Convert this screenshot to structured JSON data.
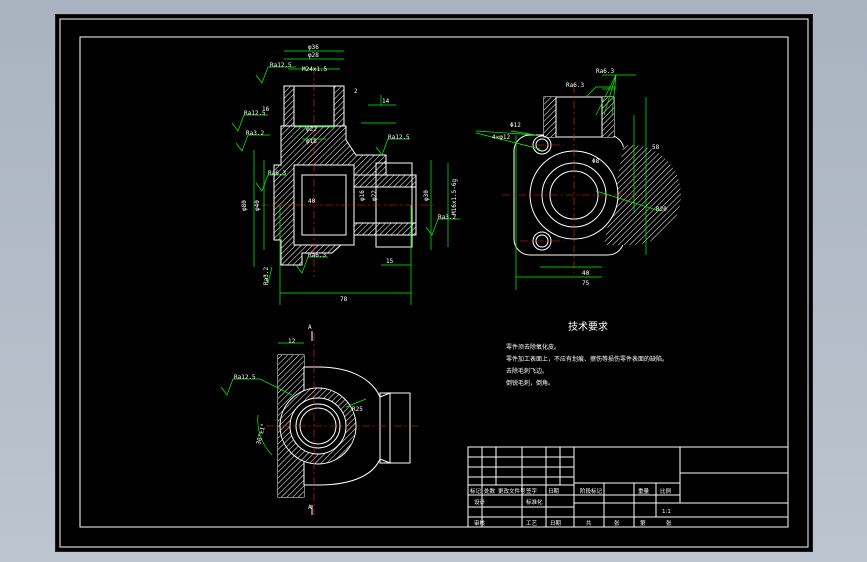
{
  "drawing": {
    "tech_requirements": {
      "title": "技术要求",
      "notes": [
        "零件须去除氧化皮。",
        "零件加工表面上，不应有划痕、擦伤等损伤零件表面的缺陷。",
        "去除毛刺飞边。",
        "倒锐毛刺，倒角。"
      ]
    },
    "dims_front": {
      "d36": "φ36",
      "d28": "φ28",
      "m": "M24x1.5",
      "d22": "φ22",
      "d18": "φ18",
      "d80": "φ80",
      "d40": "φ40",
      "d30": "φ30",
      "d22b": "φ22",
      "d16": "φ16",
      "m2": "M16x1.5-6g",
      "l78": "78",
      "l40": "40",
      "l15": "15",
      "l14": "14",
      "l16": "16",
      "l2": "2",
      "ra1": "Ra12.5",
      "ra2": "Ra12.5",
      "ra3": "Ra3.2",
      "ra4": "Ra6.3",
      "ra5": "Ra6.3",
      "ra6": "Ra3.2",
      "ra7": "Ra12.5",
      "ra8": "Ra3.2"
    },
    "dims_side": {
      "ra1": "Ra6.3",
      "ra2": "Ra6.3",
      "d12": "Φ12",
      "holes": "4×φ12",
      "l58": "58",
      "r20": "R20",
      "l40": "40",
      "l75": "75",
      "d": "Φ8"
    },
    "dims_top": {
      "a1": "A",
      "a2": "A",
      "l12": "12",
      "r": "R25",
      "ra": "Ra12.5",
      "ang": "30°±1°"
    },
    "title_block": {
      "row1": [
        "标记",
        "处数",
        "更改文件号",
        "签字",
        "日期"
      ],
      "row2": [
        "设计",
        "",
        "标准化",
        "",
        "阶段标记",
        "重量",
        "比例"
      ],
      "scale": "1:1",
      "row3": [
        "审核",
        "",
        "",
        ""
      ],
      "row4": [
        "工艺",
        "",
        "日期",
        "",
        "共",
        "张",
        "第",
        "张"
      ]
    }
  }
}
